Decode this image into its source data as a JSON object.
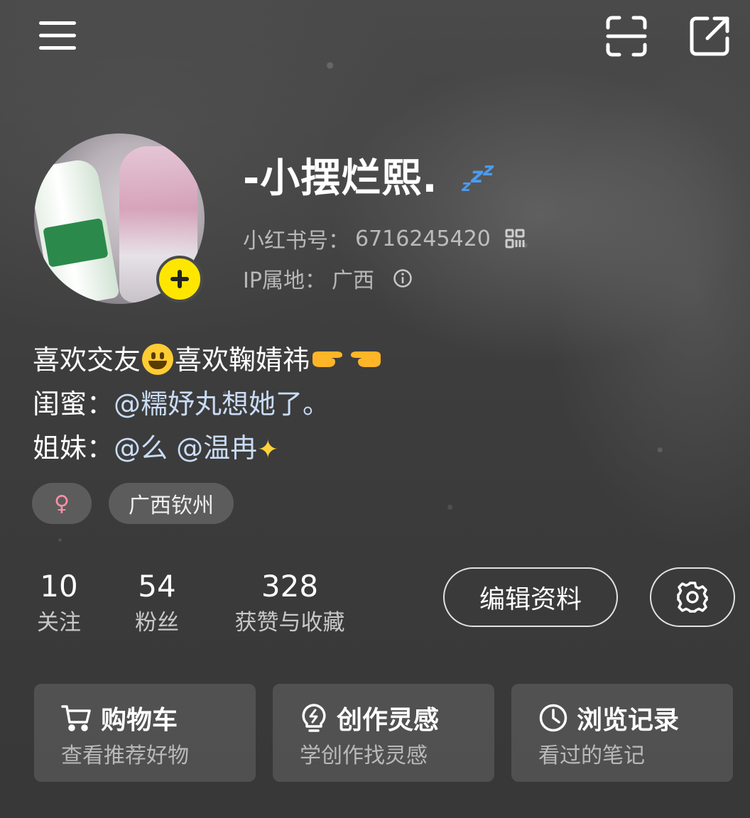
{
  "profile": {
    "username": "-小摆烂熙.",
    "username_emoji": "zzz-icon",
    "xhs_id_label": "小红书号：",
    "xhs_id": "6716245420",
    "ip_label": "IP属地：",
    "ip_value": "广西"
  },
  "bio": {
    "line1_a": "喜欢交友",
    "line1_b": "喜欢鞠婧祎",
    "line2_prefix": "闺蜜：",
    "line2_mention": "@糯妤丸想她了。",
    "line3_prefix": "姐妹：",
    "line3_mention": "@么 @温冉"
  },
  "tags": {
    "gender_icon": "♀",
    "location": "广西钦州"
  },
  "stats": [
    {
      "value": "10",
      "label": "关注"
    },
    {
      "value": "54",
      "label": "粉丝"
    },
    {
      "value": "328",
      "label": "获赞与收藏"
    }
  ],
  "actions": {
    "edit_label": "编辑资料"
  },
  "cards": [
    {
      "title": "购物车",
      "subtitle": "查看推荐好物",
      "icon": "cart-icon"
    },
    {
      "title": "创作灵感",
      "subtitle": "学创作找灵感",
      "icon": "bulb-icon"
    },
    {
      "title": "浏览记录",
      "subtitle": "看过的笔记",
      "icon": "clock-icon"
    }
  ],
  "colors": {
    "accent_yellow": "#ffe600",
    "mention_blue": "#c9dcf6",
    "gender_pink": "#ff8fa8"
  }
}
